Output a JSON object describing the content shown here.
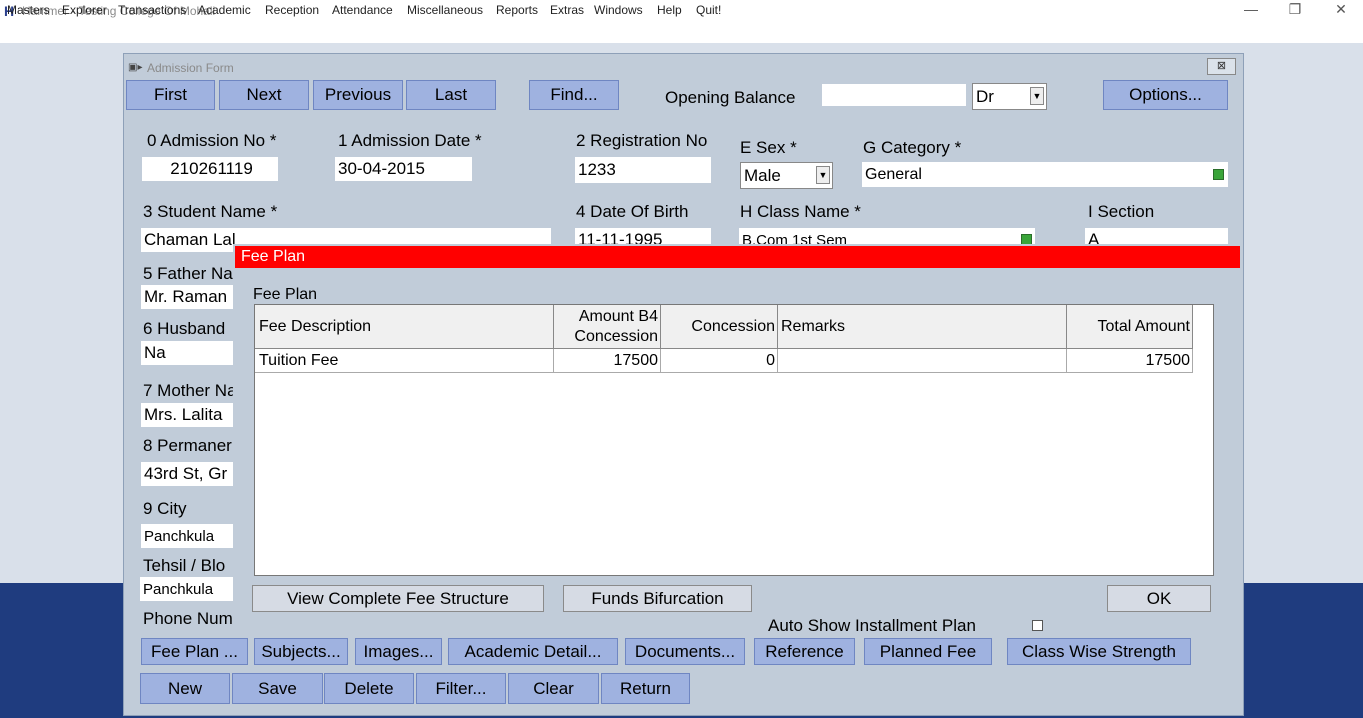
{
  "app": {
    "icon": "H",
    "title": "Hammer - Testing College Of Mohali"
  },
  "window_controls": {
    "minimize": "—",
    "restore": "❐",
    "close": "✕"
  },
  "menu": [
    "Masters",
    "Explorer",
    "Transactions",
    "Academic",
    "Reception",
    "Attendance",
    "Miscellaneous",
    "Reports",
    "Extras",
    "Windows",
    "Help",
    "Quit!"
  ],
  "form": {
    "title": "Admission Form",
    "close_label": "⊠",
    "nav": {
      "first": "First",
      "next": "Next",
      "previous": "Previous",
      "last": "Last",
      "find": "Find...",
      "options": "Options..."
    },
    "opening_balance": {
      "label": "Opening Balance",
      "value": "",
      "drcr": "Dr"
    },
    "fields": {
      "admission_no": {
        "label": "0 Admission No *",
        "value": "210261119"
      },
      "admission_date": {
        "label": "1 Admission Date *",
        "value": "30-04-2015"
      },
      "registration_no": {
        "label": "2 Registration No",
        "value": "1233"
      },
      "sex": {
        "label": "E Sex *",
        "value": "Male"
      },
      "category": {
        "label": "G Category *",
        "value": "General"
      },
      "student_name": {
        "label": "3 Student Name *",
        "value": "Chaman Lal"
      },
      "date_of_birth": {
        "label": "4 Date Of Birth",
        "value": "11-11-1995"
      },
      "class_name": {
        "label": "H Class Name *",
        "value": "B.Com 1st Sem"
      },
      "section": {
        "label": "I Section",
        "value": "A"
      },
      "father_name": {
        "label": "5 Father Na",
        "value": "Mr. Raman"
      },
      "husband": {
        "label": "6 Husband",
        "value": "Na"
      },
      "mother_name": {
        "label": "7 Mother Na",
        "value": "Mrs. Lalita"
      },
      "permanent": {
        "label": "8 Permaner",
        "value": "43rd St, Gr"
      },
      "city": {
        "label": "9 City",
        "value": "Panchkula"
      },
      "tehsil": {
        "label": "Tehsil / Blo",
        "value": "Panchkula"
      },
      "phone": {
        "label": "Phone Num"
      }
    },
    "tabs": [
      "Fee Plan ...",
      "Subjects...",
      "Images...",
      "Academic Detail...",
      "Documents...",
      "Reference",
      "Planned Fee",
      "Class Wise Strength"
    ],
    "actions": {
      "new": "New",
      "save": "Save",
      "delete": "Delete",
      "filter": "Filter...",
      "clear": "Clear",
      "return": "Return"
    }
  },
  "fee_plan": {
    "title": "Fee Plan",
    "section_label": "Fee Plan",
    "columns": [
      "Fee Description",
      "Amount B4\nConcession",
      "Concession",
      "Remarks",
      "Total Amount"
    ],
    "rows": [
      {
        "description": "Tuition Fee",
        "amount_b4": "17500",
        "concession": "0",
        "remarks": "",
        "total": "17500"
      }
    ],
    "buttons": {
      "view_structure": "View Complete Fee Structure",
      "funds": "Funds Bifurcation",
      "ok": "OK"
    },
    "auto_show": {
      "label": "Auto Show Installment Plan",
      "checked": false
    }
  }
}
